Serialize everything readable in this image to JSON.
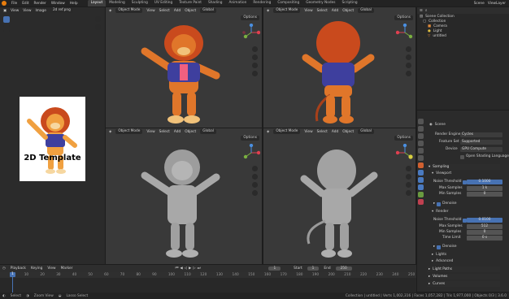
{
  "topbar": {
    "menus": [
      "File",
      "Edit",
      "Render",
      "Window",
      "Help"
    ],
    "workspaces": [
      "Layout",
      "Modeling",
      "Sculpting",
      "UV Editing",
      "Texture Paint",
      "Shading",
      "Animation",
      "Rendering",
      "Compositing",
      "Geometry Nodes",
      "Scripting"
    ],
    "active_workspace": "Layout",
    "scene": "Scene",
    "view_layer": "ViewLayer"
  },
  "image_editor": {
    "view": "View",
    "view2": "View",
    "image_menu": "Image",
    "image_name": "2d ref.png",
    "ref_text": "2D Template"
  },
  "viewports": [
    {
      "mode": "Object Mode",
      "menus": [
        "View",
        "Select",
        "Add",
        "Object"
      ],
      "orient": "Global",
      "options": "Options",
      "shading": "color"
    },
    {
      "mode": "Object Mode",
      "menus": [
        "View",
        "Select",
        "Add",
        "Object"
      ],
      "orient": "Global",
      "options": "Options",
      "shading": "color"
    },
    {
      "mode": "Object Mode",
      "menus": [
        "View",
        "Select",
        "Add",
        "Object"
      ],
      "orient": "Global",
      "options": "Options",
      "shading": "solid"
    },
    {
      "mode": "Object Mode",
      "menus": [
        "View",
        "Select",
        "Add",
        "Object"
      ],
      "orient": "Global",
      "options": "Options",
      "shading": "solid"
    }
  ],
  "outliner": {
    "root": "Scene Collection",
    "items": [
      "Collection",
      "Camera",
      "Light",
      "untitled"
    ]
  },
  "properties": {
    "scene": "Scene",
    "render_engine_label": "Render Engine",
    "render_engine": "Cycles",
    "feature_set_label": "Feature Set",
    "feature_set": "Supported",
    "device_label": "Device",
    "device": "GPU Compute",
    "osl_label": "Open Shading Language",
    "sampling": "Sampling",
    "viewport": "Viewport",
    "noise_threshold_label": "Noise Threshold",
    "vp_noise_threshold": "0.1000",
    "max_samples_label": "Max Samples",
    "vp_max_samples": "1 k",
    "min_samples_label": "Min Samples",
    "vp_min_samples": "0",
    "denoise": "Denoise",
    "render": "Render",
    "r_noise_threshold": "0.0100",
    "r_max_samples": "512",
    "r_min_samples": "0",
    "time_limit_label": "Time Limit",
    "time_limit": "0 s",
    "denoise2": "Denoise",
    "lights": "Lights",
    "advanced": "Advanced",
    "light_paths": "Light Paths",
    "volumes": "Volumes",
    "curves": "Curves"
  },
  "timeline": {
    "menus": [
      "Playback",
      "Keying",
      "View",
      "Marker"
    ],
    "current_frame": "1",
    "start_label": "Start",
    "start": "1",
    "end_label": "End",
    "end": "250",
    "ticks": [
      "1",
      "10",
      "20",
      "30",
      "40",
      "50",
      "60",
      "70",
      "80",
      "90",
      "100",
      "110",
      "120",
      "130",
      "140",
      "150",
      "160",
      "170",
      "180",
      "190",
      "200",
      "210",
      "220",
      "230",
      "240",
      "250"
    ]
  },
  "status": {
    "select": "Select",
    "zoom": "Zoom View",
    "lasso": "Lasso Select",
    "info": "Collection | untitled | Verts 1,002,316 | Faces 1,057,282 | Tris 1,977,000 | Objects 0/3 | 3.6.0"
  },
  "colors": {
    "accent": "#4772b3",
    "lion_orange": "#e0762a",
    "mane": "#c94a1d",
    "vest": "#3e3f9e",
    "clay": "#a8a8a8"
  }
}
